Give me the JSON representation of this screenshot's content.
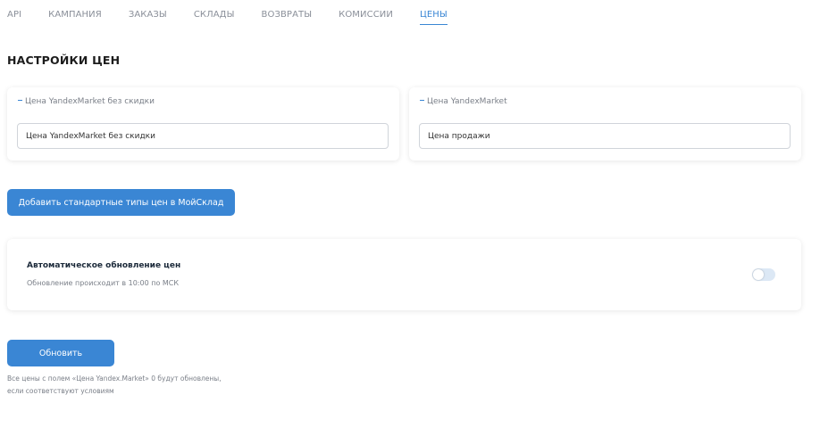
{
  "tabs": [
    {
      "label": "API",
      "active": false
    },
    {
      "label": "КАМПАНИЯ",
      "active": false
    },
    {
      "label": "ЗАКАЗЫ",
      "active": false
    },
    {
      "label": "СКЛАДЫ",
      "active": false
    },
    {
      "label": "ВОЗВРАТЫ",
      "active": false
    },
    {
      "label": "КОМИССИИ",
      "active": false
    },
    {
      "label": "ЦЕНЫ",
      "active": true
    }
  ],
  "page": {
    "title": "НАСТРОЙКИ ЦЕН"
  },
  "price_fields": {
    "base": {
      "label": "Цена YandexMarket без скидки",
      "value": "Цена YandexMarket без скидки"
    },
    "sale": {
      "label": "Цена YandexMarket",
      "value": "Цена продажи"
    }
  },
  "buttons": {
    "add_label": "Добавить стандартные типы цен в МойСклад",
    "update_label": "Обновить"
  },
  "auto_update": {
    "title": "Автоматическое обновление цен",
    "subtitle": "Обновление происходит в 10:00 по МСК",
    "enabled": false
  },
  "note": {
    "line1": "Все цены с полем «Цена Yandex.Market» 0 будут обновлены,",
    "line2": "если соответствуют условиям"
  },
  "colors": {
    "accent": "#3a86d4",
    "toggle_off": "#dce8f5"
  }
}
